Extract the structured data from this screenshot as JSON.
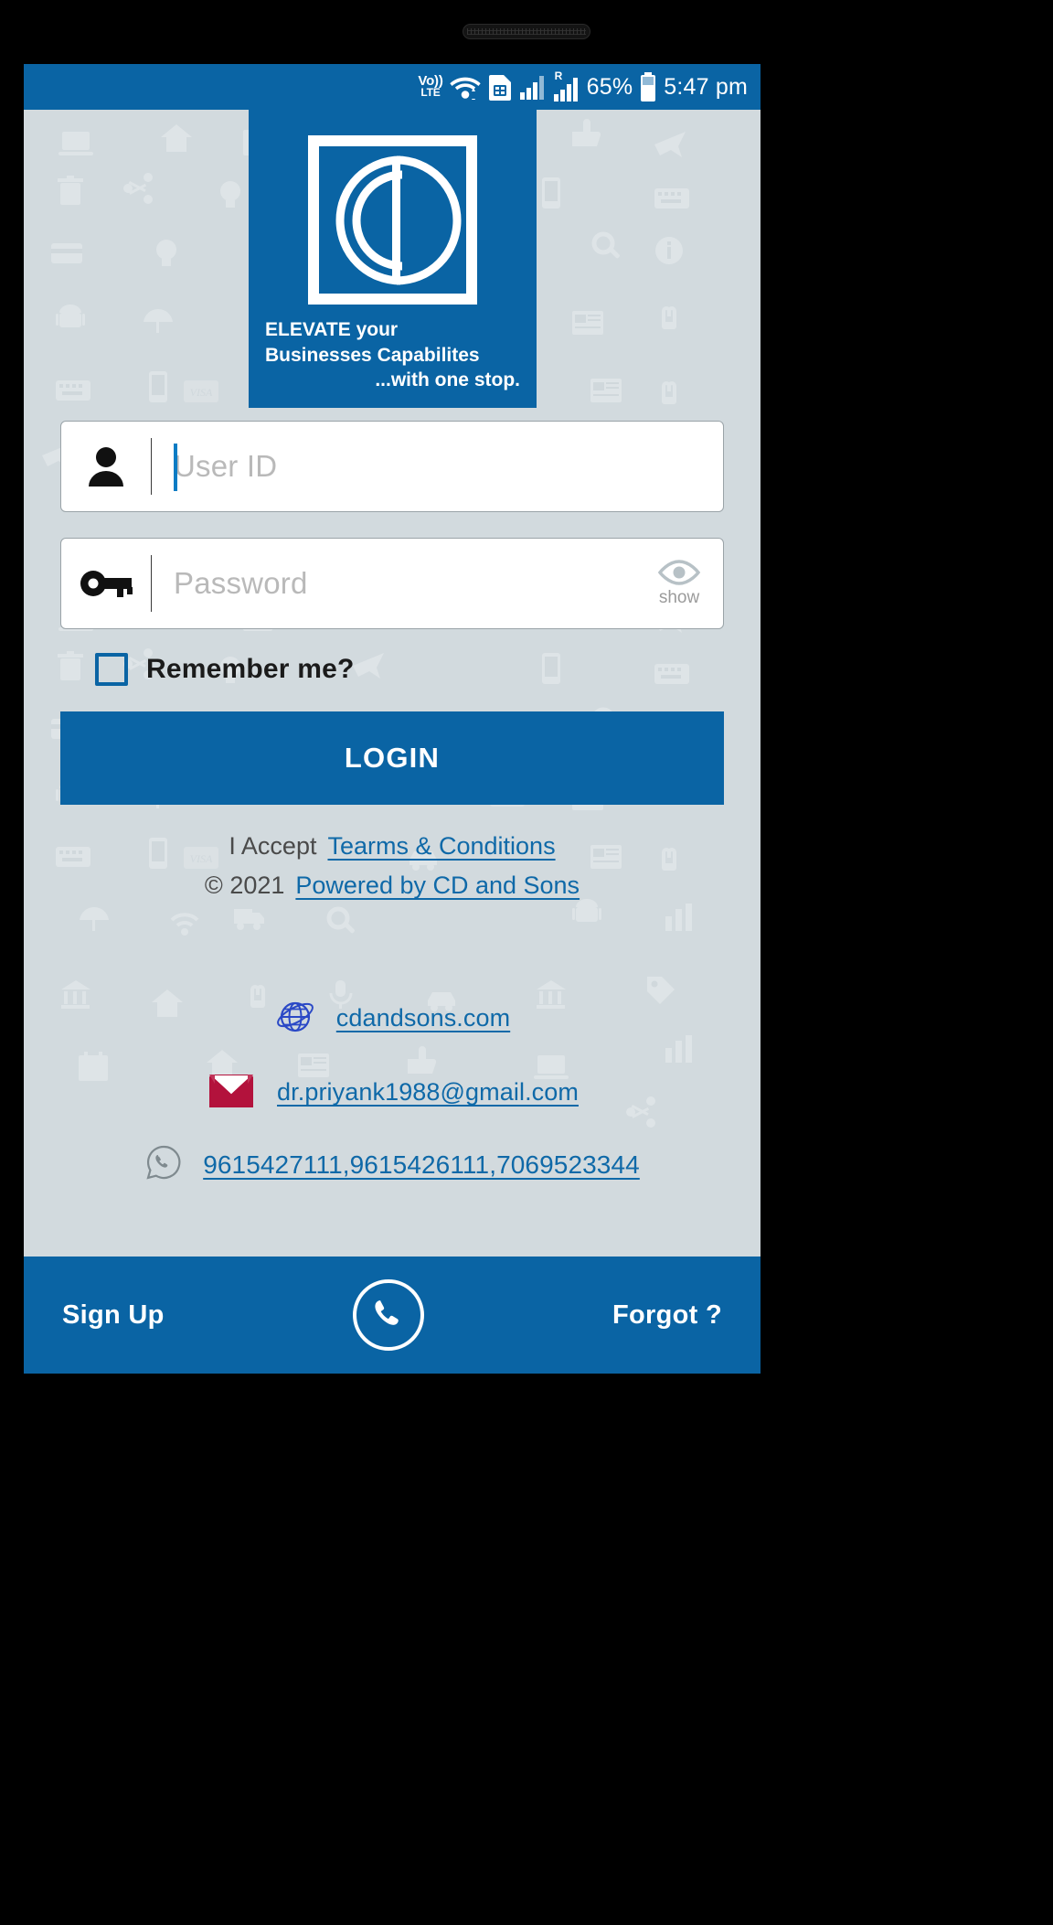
{
  "statusbar": {
    "volte_top": "Vo))",
    "volte_bottom": "LTE",
    "roaming_letter": "R",
    "battery_percent": "65%",
    "time": "5:47 pm",
    "icons": [
      "volte-icon",
      "wifi-icon",
      "sim-card-icon",
      "signal-bars-icon",
      "signal-bars-roaming-icon",
      "battery-icon"
    ]
  },
  "logo": {
    "monogram": "CD",
    "tagline_line1_bold": "ELEVATE",
    "tagline_line1_rest": " your",
    "tagline_line2": "Businesses Capabilites",
    "tagline_line3": "...with one stop."
  },
  "form": {
    "user": {
      "placeholder": "User ID",
      "value": "",
      "icon": "person-icon"
    },
    "password": {
      "placeholder": "Password",
      "value": "",
      "icon": "key-icon",
      "toggle_label": "show",
      "toggle_icon": "eye-icon"
    },
    "remember": {
      "label": "Remember me?",
      "checked": false
    },
    "login_label": "LOGIN"
  },
  "legal": {
    "accept_prefix": "I Accept",
    "terms_link": "Tearms & Conditions",
    "copyright": "© 2021",
    "powered_link": "Powered by CD and Sons"
  },
  "contacts": [
    {
      "icon": "globe-icon",
      "text": "cdandsons.com"
    },
    {
      "icon": "gmail-icon",
      "text": "dr.priyank1988@gmail.com"
    },
    {
      "icon": "whatsapp-icon",
      "text": "9615427111,9615426111,7069523344"
    }
  ],
  "bottombar": {
    "signup_label": "Sign Up",
    "call_icon": "phone-icon",
    "forgot_label": "Forgot ?"
  },
  "colors": {
    "brand_blue": "#0A64A4",
    "screen_bg": "#D2DADE",
    "link_blue": "#0F69A8",
    "gmail_red": "#B3123C",
    "globe_blue": "#2B49C6"
  }
}
